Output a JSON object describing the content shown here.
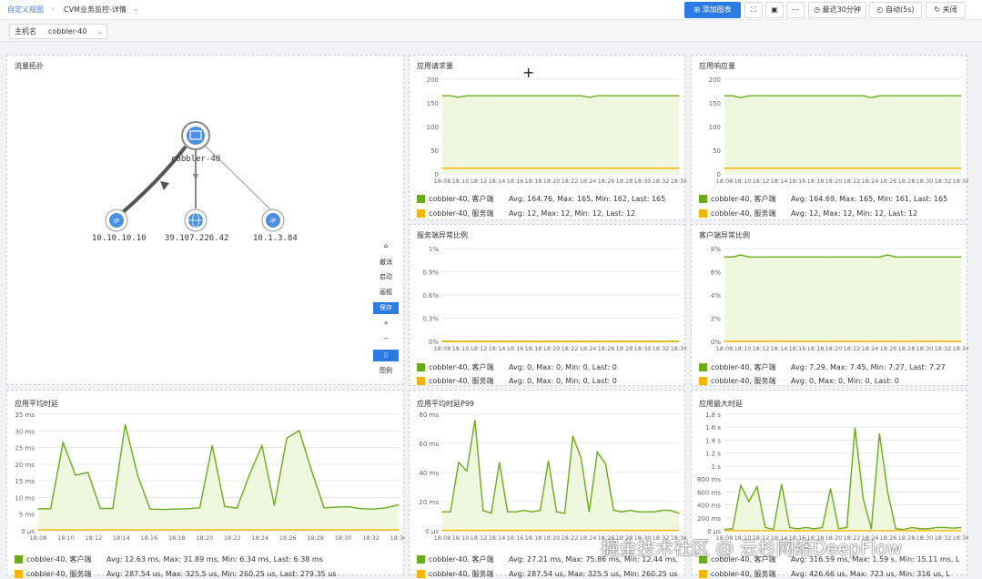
{
  "topbar": {
    "breadcrumb_root": "自定义视图",
    "breadcrumb_current": "CVM业务监控-详情",
    "add_chart": "添加图表",
    "time_range": "最近30分钟",
    "auto_refresh": "自动(5s)",
    "close": "关闭"
  },
  "filter": {
    "label": "主机名",
    "value": "cobbler-40"
  },
  "colors": {
    "client": "#6aab1c",
    "server": "#f5b400",
    "fill": "#eef6dc",
    "accent": "#2c7be5"
  },
  "topology": {
    "title": "流量拓扑",
    "center": "cobbler-40",
    "nodes": [
      "10.10.10.10",
      "39.107.226.42",
      "10.1.3.84"
    ],
    "controls": [
      "撤消",
      "启动",
      "画框",
      "保存",
      "图例"
    ]
  },
  "panels": [
    {
      "title": "应用请求量",
      "legend": [
        {
          "name": "cobbler-40, 客户端",
          "stats": "Avg: 164.76, Max: 165, Min: 162, Last: 165"
        },
        {
          "name": "cobbler-40, 服务端",
          "stats": "Avg: 12, Max: 12, Min: 12, Last: 12"
        }
      ]
    },
    {
      "title": "应用响应量",
      "legend": [
        {
          "name": "cobbler-40, 客户端",
          "stats": "Avg: 164.69, Max: 165, Min: 161, Last: 165"
        },
        {
          "name": "cobbler-40, 服务端",
          "stats": "Avg: 12, Max: 12, Min: 12, Last: 12"
        }
      ]
    },
    {
      "title": "服务端异常比例",
      "legend": [
        {
          "name": "cobbler-40, 客户端",
          "stats": "Avg: 0, Max: 0, Min: 0, Last: 0"
        },
        {
          "name": "cobbler-40, 服务端",
          "stats": "Avg: 0, Max: 0, Min: 0, Last: 0"
        }
      ]
    },
    {
      "title": "客户端异常比例",
      "legend": [
        {
          "name": "cobbler-40, 客户端",
          "stats": "Avg: 7.29, Max: 7.45, Min: 7.27, Last: 7.27"
        },
        {
          "name": "cobbler-40, 服务端",
          "stats": "Avg: 0, Max: 0, Min: 0, Last: 0"
        }
      ]
    },
    {
      "title": "应用平均时延",
      "legend": [
        {
          "name": "cobbler-40, 客户端",
          "stats": "Avg: 12.63 ms, Max: 31.89 ms, Min: 6.34 ms, Last: 6.38 ms"
        },
        {
          "name": "cobbler-40, 服务端",
          "stats": "Avg: 287.54 us, Max: 325.5 us, Min: 260.25 us, Last: 279.35 us"
        }
      ]
    },
    {
      "title": "应用平均时延P99",
      "legend": [
        {
          "name": "cobbler-40, 客户端",
          "stats": "Avg: 27.21 ms, Max: 75.86 ms, Min: 12.44 ms,"
        },
        {
          "name": "cobbler-40, 服务端",
          "stats": "Avg: 287.54 us, Max: 325.5 us, Min: 260.25 us"
        }
      ]
    },
    {
      "title": "应用最大时延",
      "legend": [
        {
          "name": "cobbler-40, 客户端",
          "stats": "Avg: 316.59 ms, Max: 1.59 s, Min: 15.11 ms, L"
        },
        {
          "name": "cobbler-40, 服务端",
          "stats": "Avg: 426.66 us, Max: 723 us, Min: 316 us, L"
        }
      ]
    }
  ],
  "chart_data": [
    {
      "type": "line",
      "title": "应用请求量",
      "x": [
        "18:08",
        "18:10",
        "18:12",
        "18:14",
        "18:16",
        "18:18",
        "18:20",
        "18:22",
        "18:24",
        "18:26",
        "18:28",
        "18:30",
        "18:32",
        "18:34"
      ],
      "y_ticks": [
        "0",
        "50",
        "100",
        "150",
        "200"
      ],
      "ylim": [
        0,
        200
      ],
      "series": [
        {
          "name": "cobbler-40, 客户端",
          "values": [
            165,
            165,
            162,
            165,
            165,
            165,
            165,
            165,
            165,
            165,
            165,
            165,
            165,
            165,
            165,
            165,
            165,
            165,
            162,
            165,
            165,
            165,
            165,
            165,
            165,
            165,
            165,
            165,
            165,
            165
          ]
        },
        {
          "name": "cobbler-40, 服务端",
          "values": [
            12,
            12,
            12,
            12,
            12,
            12,
            12,
            12,
            12,
            12,
            12,
            12,
            12,
            12,
            12,
            12,
            12,
            12,
            12,
            12,
            12,
            12,
            12,
            12,
            12,
            12,
            12,
            12,
            12,
            12
          ]
        }
      ]
    },
    {
      "type": "line",
      "title": "应用响应量",
      "x": [
        "18:08",
        "18:10",
        "18:12",
        "18:14",
        "18:16",
        "18:18",
        "18:20",
        "18:22",
        "18:24",
        "18:26",
        "18:28",
        "18:30",
        "18:32",
        "18:34"
      ],
      "y_ticks": [
        "0",
        "50",
        "100",
        "150",
        "200"
      ],
      "ylim": [
        0,
        200
      ],
      "series": [
        {
          "name": "cobbler-40, 客户端",
          "values": [
            165,
            165,
            161,
            165,
            165,
            165,
            165,
            165,
            165,
            165,
            165,
            165,
            165,
            165,
            165,
            165,
            165,
            165,
            161,
            165,
            165,
            165,
            165,
            165,
            165,
            165,
            165,
            165,
            165,
            165
          ]
        },
        {
          "name": "cobbler-40, 服务端",
          "values": [
            12,
            12,
            12,
            12,
            12,
            12,
            12,
            12,
            12,
            12,
            12,
            12,
            12,
            12,
            12,
            12,
            12,
            12,
            12,
            12,
            12,
            12,
            12,
            12,
            12,
            12,
            12,
            12,
            12,
            12
          ]
        }
      ]
    },
    {
      "type": "line",
      "title": "服务端异常比例",
      "x": [
        "18:08",
        "18:10",
        "18:12",
        "18:14",
        "18:16",
        "18:18",
        "18:20",
        "18:22",
        "18:24",
        "18:26",
        "18:28",
        "18:30",
        "18:32",
        "18:34"
      ],
      "y_ticks": [
        "0%",
        "0.3%",
        "0.6%",
        "0.9%",
        "1%"
      ],
      "ylim": [
        0,
        1
      ],
      "series": [
        {
          "name": "cobbler-40, 客户端",
          "values": [
            0,
            0,
            0,
            0,
            0,
            0,
            0,
            0,
            0,
            0,
            0,
            0,
            0,
            0,
            0,
            0,
            0,
            0,
            0,
            0,
            0,
            0,
            0,
            0,
            0,
            0,
            0,
            0,
            0,
            0
          ]
        },
        {
          "name": "cobbler-40, 服务端",
          "values": [
            0,
            0,
            0,
            0,
            0,
            0,
            0,
            0,
            0,
            0,
            0,
            0,
            0,
            0,
            0,
            0,
            0,
            0,
            0,
            0,
            0,
            0,
            0,
            0,
            0,
            0,
            0,
            0,
            0,
            0
          ]
        }
      ]
    },
    {
      "type": "line",
      "title": "客户端异常比例",
      "x": [
        "18:08",
        "18:10",
        "18:12",
        "18:14",
        "18:16",
        "18:18",
        "18:20",
        "18:22",
        "18:24",
        "18:26",
        "18:28",
        "18:30",
        "18:32",
        "18:34"
      ],
      "y_ticks": [
        "0%",
        "2%",
        "4%",
        "6%",
        "8%"
      ],
      "ylim": [
        0,
        8
      ],
      "series": [
        {
          "name": "cobbler-40, 客户端",
          "values": [
            7.27,
            7.27,
            7.45,
            7.27,
            7.27,
            7.27,
            7.27,
            7.27,
            7.27,
            7.27,
            7.27,
            7.27,
            7.27,
            7.27,
            7.27,
            7.27,
            7.27,
            7.27,
            7.27,
            7.27,
            7.45,
            7.27,
            7.27,
            7.27,
            7.27,
            7.27,
            7.27,
            7.27,
            7.27,
            7.27
          ]
        },
        {
          "name": "cobbler-40, 服务端",
          "values": [
            0,
            0,
            0,
            0,
            0,
            0,
            0,
            0,
            0,
            0,
            0,
            0,
            0,
            0,
            0,
            0,
            0,
            0,
            0,
            0,
            0,
            0,
            0,
            0,
            0,
            0,
            0,
            0,
            0,
            0
          ]
        }
      ]
    },
    {
      "type": "area",
      "title": "应用平均时延",
      "x": [
        "18:08",
        "18:10",
        "18:12",
        "18:14",
        "18:16",
        "18:18",
        "18:20",
        "18:22",
        "18:24",
        "18:26",
        "18:28",
        "18:30",
        "18:32",
        "18:34"
      ],
      "y_ticks": [
        "0 µs",
        "5 ms",
        "10 ms",
        "15 ms",
        "20 ms",
        "25 ms",
        "30 ms",
        "35 ms"
      ],
      "ylim": [
        0,
        35
      ],
      "series": [
        {
          "name": "cobbler-40, 客户端",
          "values": [
            6.6,
            6.6,
            26.5,
            16.7,
            17.5,
            6.7,
            6.7,
            31.9,
            16.7,
            6.5,
            6.4,
            6.5,
            6.6,
            6.9,
            25.6,
            7.3,
            6.8,
            16.9,
            25.6,
            7.6,
            27.8,
            30.1,
            18.0,
            6.9,
            7.1,
            7.2,
            6.6,
            6.5,
            6.9,
            7.8
          ]
        },
        {
          "name": "cobbler-40, 服务端",
          "values": [
            0.29,
            0.29,
            0.29,
            0.29,
            0.29,
            0.29,
            0.29,
            0.29,
            0.29,
            0.29,
            0.29,
            0.29,
            0.29,
            0.29,
            0.29,
            0.29,
            0.29,
            0.29,
            0.29,
            0.29,
            0.29,
            0.29,
            0.29,
            0.29,
            0.29,
            0.29,
            0.29,
            0.29,
            0.29,
            0.29
          ]
        }
      ]
    },
    {
      "type": "area",
      "title": "应用平均时延P99",
      "x": [
        "18:08",
        "18:10",
        "18:12",
        "18:14",
        "18:16",
        "18:18",
        "18:20",
        "18:22",
        "18:24",
        "18:26",
        "18:28",
        "18:30",
        "18:32",
        "18:34"
      ],
      "y_ticks": [
        "0 µs",
        "20 ms",
        "40 ms",
        "60 ms",
        "80 ms"
      ],
      "ylim": [
        0,
        80
      ],
      "series": [
        {
          "name": "cobbler-40, 客户端",
          "values": [
            13,
            13,
            47,
            41,
            76,
            14,
            12,
            47,
            13,
            13,
            14,
            13,
            14,
            48,
            13,
            12,
            65,
            50,
            13,
            54,
            46,
            14,
            13,
            14,
            13,
            13,
            13,
            14,
            14,
            12
          ]
        },
        {
          "name": "cobbler-40, 服务端",
          "values": [
            0.3,
            0.3,
            0.3,
            0.3,
            0.3,
            0.3,
            0.3,
            0.3,
            0.3,
            0.3,
            0.3,
            0.3,
            0.3,
            0.3,
            0.3,
            0.3,
            0.3,
            0.3,
            0.3,
            0.3,
            0.3,
            0.3,
            0.3,
            0.3,
            0.3,
            0.3,
            0.3,
            0.3,
            0.3,
            0.3
          ]
        }
      ]
    },
    {
      "type": "area",
      "title": "应用最大时延",
      "x": [
        "18:08",
        "18:10",
        "18:12",
        "18:14",
        "18:16",
        "18:18",
        "18:20",
        "18:22",
        "18:24",
        "18:26",
        "18:28",
        "18:30",
        "18:32",
        "18:34"
      ],
      "y_ticks": [
        "0 µs",
        "200 ms",
        "400 ms",
        "600 ms",
        "800 ms",
        "1 s",
        "1.2 s",
        "1.4 s",
        "1.6 s",
        "1.8 s"
      ],
      "ylim": [
        0,
        1.8
      ],
      "series": [
        {
          "name": "cobbler-40, 客户端",
          "values": [
            0.02,
            0.03,
            0.7,
            0.45,
            0.68,
            0.05,
            0.02,
            0.72,
            0.05,
            0.03,
            0.05,
            0.03,
            0.05,
            0.65,
            0.03,
            0.05,
            1.59,
            0.5,
            0.03,
            1.5,
            0.6,
            0.03,
            0.02,
            0.05,
            0.03,
            0.03,
            0.05,
            0.05,
            0.04,
            0.05
          ]
        },
        {
          "name": "cobbler-40, 服务端",
          "values": [
            0.0004,
            0.0004,
            0.0004,
            0.0004,
            0.0004,
            0.0004,
            0.0004,
            0.0004,
            0.0004,
            0.0004,
            0.0004,
            0.0004,
            0.0004,
            0.0004,
            0.0004,
            0.0004,
            0.0004,
            0.0004,
            0.0004,
            0.0004,
            0.0004,
            0.0004,
            0.0004,
            0.0004,
            0.0004,
            0.0004,
            0.0004,
            0.0004,
            0.0004,
            0.0004
          ]
        }
      ]
    }
  ],
  "watermark": "掘金技术社区 @ 云杉网络DeepFlow"
}
